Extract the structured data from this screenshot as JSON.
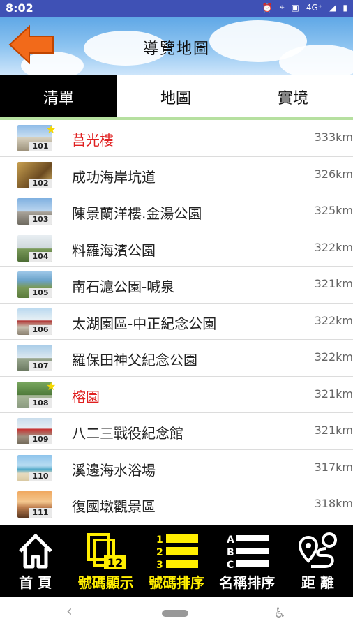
{
  "status": {
    "time": "8:02",
    "network": "4G⁺"
  },
  "header": {
    "title": "導覽地圖"
  },
  "tabs": [
    {
      "label": "清單",
      "active": true
    },
    {
      "label": "地圖",
      "active": false
    },
    {
      "label": "實境",
      "active": false
    }
  ],
  "items": [
    {
      "num": "101",
      "name": "莒光樓",
      "dist": "333km",
      "fav": true
    },
    {
      "num": "102",
      "name": "成功海岸坑道",
      "dist": "326km",
      "fav": false
    },
    {
      "num": "103",
      "name": "陳景蘭洋樓.金湯公園",
      "dist": "325km",
      "fav": false
    },
    {
      "num": "104",
      "name": "料羅海濱公園",
      "dist": "322km",
      "fav": false
    },
    {
      "num": "105",
      "name": "南石滬公園-喊泉",
      "dist": "321km",
      "fav": false
    },
    {
      "num": "106",
      "name": "太湖園區-中正紀念公園",
      "dist": "322km",
      "fav": false
    },
    {
      "num": "107",
      "name": "羅保田神父紀念公園",
      "dist": "322km",
      "fav": false
    },
    {
      "num": "108",
      "name": "榕園",
      "dist": "321km",
      "fav": true
    },
    {
      "num": "109",
      "name": "八二三戰役紀念館",
      "dist": "321km",
      "fav": false
    },
    {
      "num": "110",
      "name": "溪邊海水浴場",
      "dist": "317km",
      "fav": false
    },
    {
      "num": "111",
      "name": "復國墩觀景區",
      "dist": "318km",
      "fav": false
    }
  ],
  "toolbar": {
    "home": "首 頁",
    "num_display": "號碼顯示",
    "num_display_badge": "12",
    "num_sort": "號碼排序",
    "name_sort": "名稱排序",
    "distance": "距 離"
  },
  "colors": {
    "accent": "#ffee00",
    "fav": "#e02020",
    "active_tab": "#000000"
  }
}
